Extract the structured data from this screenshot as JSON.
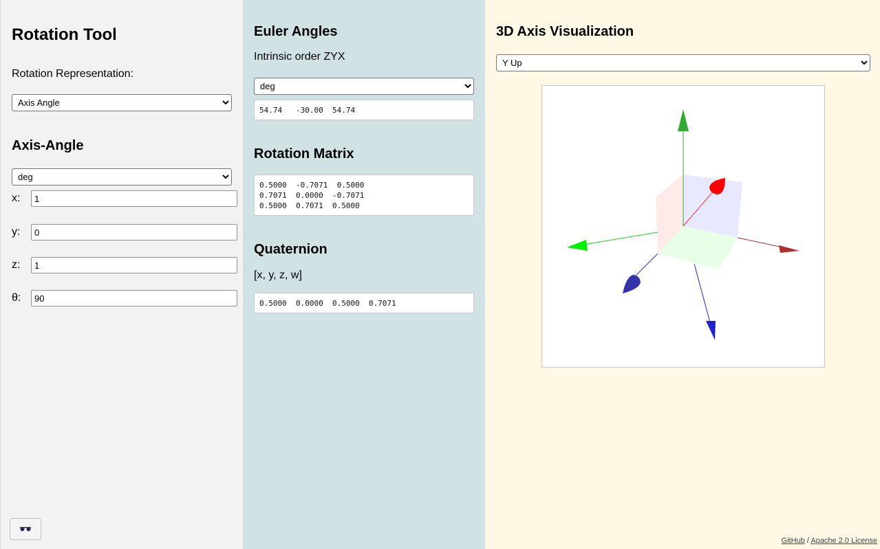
{
  "left": {
    "title": "Rotation Tool",
    "representation_label": "Rotation Representation:",
    "representation_value": "Axis Angle",
    "section_title": "Axis-Angle",
    "unit_value": "deg",
    "fields": [
      {
        "label": "x:",
        "value": "1"
      },
      {
        "label": "y:",
        "value": "0"
      },
      {
        "label": "z:",
        "value": "1"
      },
      {
        "label": "θ:",
        "value": "90"
      }
    ],
    "glasses_icon": "glasses-icon"
  },
  "middle": {
    "euler_title": "Euler Angles",
    "euler_order": "Intrinsic order ZYX",
    "euler_unit": "deg",
    "euler_values": "54.74   -30.00  54.74",
    "matrix_title": "Rotation Matrix",
    "matrix_values": "0.5000  -0.7071  0.5000\n0.7071  0.0000  -0.7071\n0.5000  0.7071  0.5000",
    "quat_title": "Quaternion",
    "quat_order": "[x, y, z, w]",
    "quat_values": "0.5000  0.0000  0.5000  0.7071"
  },
  "right": {
    "title": "3D Axis Visualization",
    "up_value": "Y Up",
    "colors": {
      "x_axis": "#b03030",
      "y_axis": "#33aa33",
      "z_axis": "#2222cc",
      "rot_x": "#ff0000",
      "rot_y": "#00ee00",
      "rot_z": "#3333aa"
    }
  },
  "footer": {
    "github": "GitHub",
    "separator": " / ",
    "license": "Apache 2.0 License"
  }
}
